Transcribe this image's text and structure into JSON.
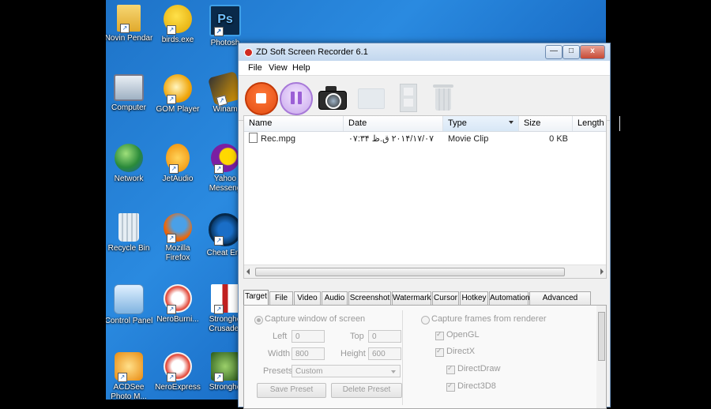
{
  "desktop": {
    "icons": [
      {
        "label": "Novin Pendar",
        "icon": "folder-icon"
      },
      {
        "label": "birds.exe",
        "icon": "bird-icon"
      },
      {
        "label": "Photosh",
        "icon": "photoshop-icon"
      },
      {
        "label": "Computer",
        "icon": "computer-icon"
      },
      {
        "label": "GOM Player",
        "icon": "gom-player-icon"
      },
      {
        "label": "Winam",
        "icon": "winamp-icon"
      },
      {
        "label": "Network",
        "icon": "network-globe-icon"
      },
      {
        "label": "JetAudio",
        "icon": "jetaudio-icon"
      },
      {
        "label": "Yahoo Messeng",
        "icon": "yahoo-messenger-icon"
      },
      {
        "label": "Recycle Bin",
        "icon": "recycle-bin-icon"
      },
      {
        "label": "Mozilla Firefox",
        "icon": "firefox-icon"
      },
      {
        "label": "Cheat Enc",
        "icon": "cheat-engine-icon"
      },
      {
        "label": "Control Panel",
        "icon": "control-panel-icon"
      },
      {
        "label": "NeroBurni...",
        "icon": "nero-icon"
      },
      {
        "label": "Strongho Crusader",
        "icon": "stronghold-crusader-icon"
      },
      {
        "label": "ACDSee Photo M...",
        "icon": "acdsee-icon"
      },
      {
        "label": "NeroExpress",
        "icon": "nero-express-icon"
      },
      {
        "label": "Strongho",
        "icon": "stronghold-icon"
      }
    ]
  },
  "window": {
    "title": "ZD Soft Screen Recorder 6.1",
    "buttons": {
      "minimize": "—",
      "maximize": "□",
      "close": "x"
    }
  },
  "menu": {
    "file": "File",
    "view": "View",
    "help": "Help"
  },
  "toolbar": {
    "record": "record-icon",
    "pause": "pause-icon",
    "screenshot": "camera-icon",
    "open_folder": "folder-icon",
    "play": "film-icon",
    "delete": "trash-icon"
  },
  "list": {
    "columns": [
      "Name",
      "Date",
      "Type",
      "Size",
      "Length"
    ],
    "sorted_column": "Type",
    "rows": [
      {
        "name": "Rec.mpg",
        "date": "۲۰۱۴/۱۷/۰۷ ق.ظ ۰۷:۳۴",
        "type": "Movie Clip",
        "size": "0 KB",
        "length": ""
      }
    ]
  },
  "tabs": [
    "Target",
    "File",
    "Video",
    "Audio",
    "Screenshot",
    "Watermark",
    "Cursor",
    "Hotkey",
    "Automation",
    "Advanced Options"
  ],
  "active_tab": "Target",
  "target": {
    "capture_window": "Capture window of screen",
    "left_label": "Left",
    "left_value": "0",
    "top_label": "Top",
    "top_value": "0",
    "width_label": "Width",
    "width_value": "800",
    "height_label": "Height",
    "height_value": "600",
    "presets_label": "Presets",
    "presets_value": "Custom",
    "save_preset": "Save Preset",
    "delete_preset": "Delete Preset",
    "capture_renderer": "Capture frames from renderer",
    "opengl": "OpenGL",
    "directx": "DirectX",
    "directdraw": "DirectDraw",
    "direct3d8": "Direct3D8"
  },
  "colors": {
    "desktop": "#1e73c8",
    "record": "#e24a10",
    "pause": "#c7a6ec"
  }
}
